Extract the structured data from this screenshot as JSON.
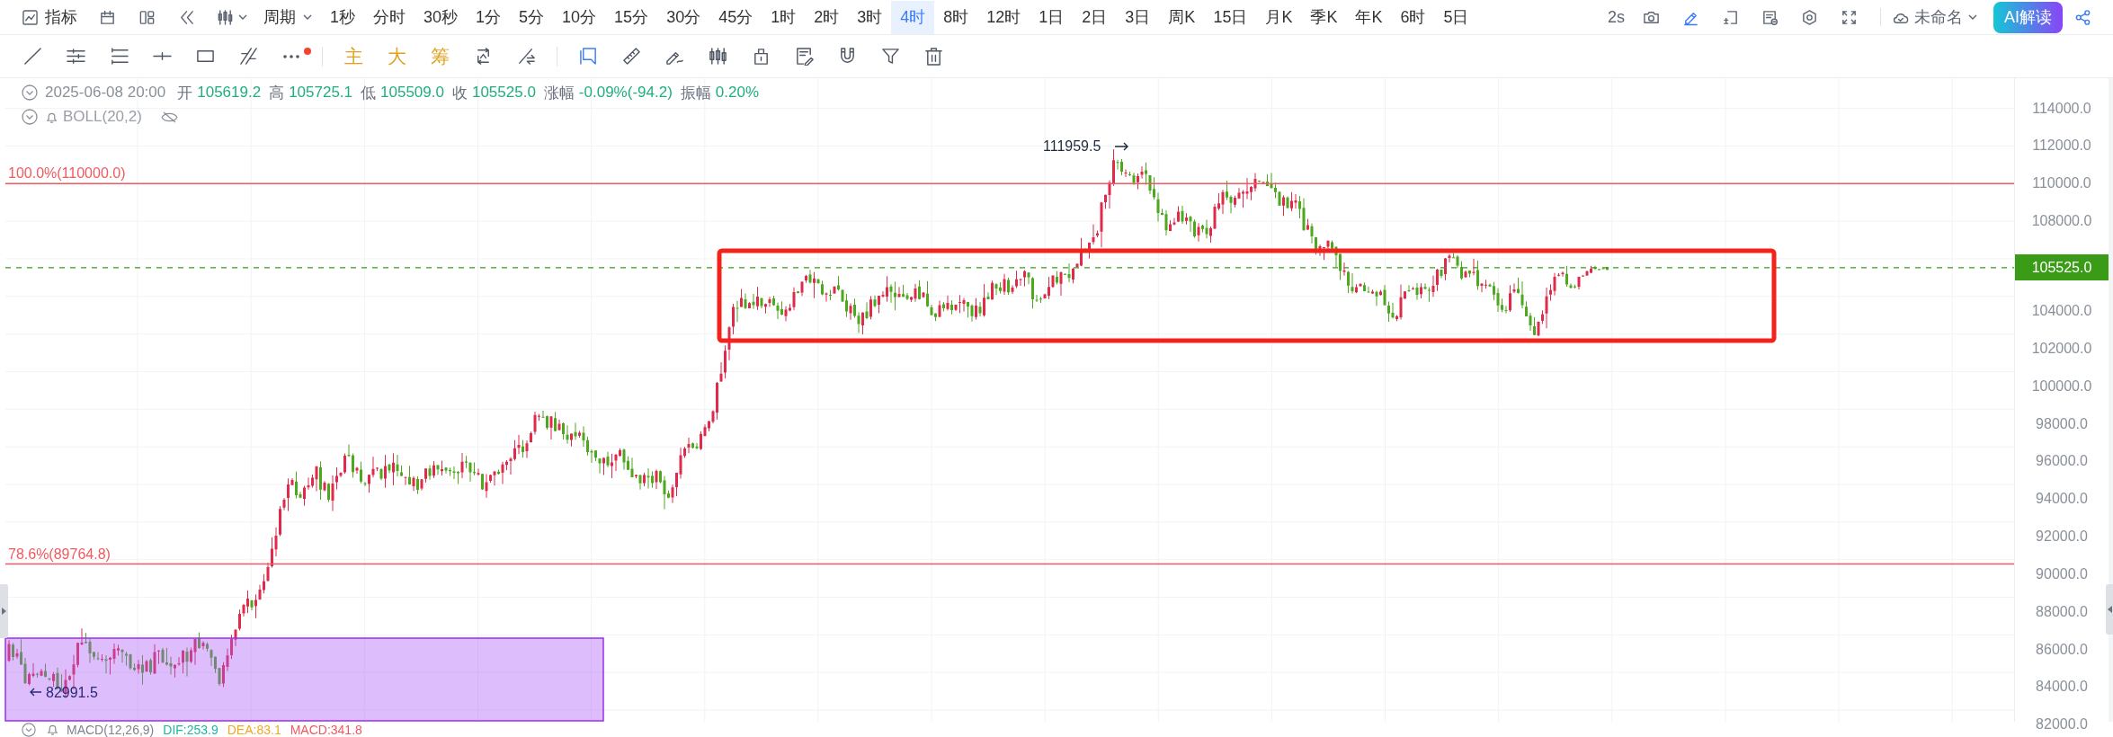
{
  "toolbar": {
    "indicators_button": {
      "label": "指标"
    },
    "period_menu": {
      "label": "周期"
    },
    "intervals": [
      {
        "label": "1秒",
        "selected": false
      },
      {
        "label": "分时",
        "selected": false
      },
      {
        "label": "30秒",
        "selected": false
      },
      {
        "label": "1分",
        "selected": false
      },
      {
        "label": "5分",
        "selected": false
      },
      {
        "label": "10分",
        "selected": false
      },
      {
        "label": "15分",
        "selected": false
      },
      {
        "label": "30分",
        "selected": false
      },
      {
        "label": "45分",
        "selected": false
      },
      {
        "label": "1时",
        "selected": false
      },
      {
        "label": "2时",
        "selected": false
      },
      {
        "label": "3时",
        "selected": false
      },
      {
        "label": "4时",
        "selected": true
      },
      {
        "label": "8时",
        "selected": false
      },
      {
        "label": "12时",
        "selected": false
      },
      {
        "label": "1日",
        "selected": false
      },
      {
        "label": "2日",
        "selected": false
      },
      {
        "label": "3日",
        "selected": false
      },
      {
        "label": "周K",
        "selected": false
      },
      {
        "label": "15日",
        "selected": false
      },
      {
        "label": "月K",
        "selected": false
      },
      {
        "label": "季K",
        "selected": false
      },
      {
        "label": "年K",
        "selected": false
      },
      {
        "label": "6时",
        "selected": false
      },
      {
        "label": "5日",
        "selected": false
      }
    ],
    "refresh_rate": {
      "label": "2s"
    },
    "draw_toggle": {
      "on": true
    },
    "layout_menu": {
      "label": "未命名"
    },
    "ai_button": {
      "label": "AI解读"
    }
  },
  "drawing_tools": {
    "more_badge": true,
    "quick_buttons": [
      {
        "label": "主"
      },
      {
        "label": "大"
      },
      {
        "label": "筹"
      }
    ],
    "keep_drawing": {
      "on": true
    }
  },
  "legend": {
    "datetime": "2025-06-08 20:00",
    "fields": [
      {
        "label": "开",
        "value": "105619.2"
      },
      {
        "label": "高",
        "value": "105725.1"
      },
      {
        "label": "低",
        "value": "105509.0"
      },
      {
        "label": "收",
        "value": "105525.0"
      },
      {
        "label": "涨幅",
        "value": "-0.09%(-94.2)"
      },
      {
        "label": "振幅",
        "value": "0.20%"
      }
    ]
  },
  "indicator_rows": [
    {
      "name": "BOLL(20,2)",
      "visible": false
    }
  ],
  "chart": {
    "fib_levels": [
      {
        "label": "100.0%(110000.0)"
      },
      {
        "label": "78.6%(89764.8)"
      }
    ],
    "high_marker": {
      "label": "111959.5"
    },
    "low_marker": {
      "label": "82991.5"
    }
  },
  "price_axis": {
    "upper_labels": [
      "114000.0",
      "112000.0",
      "110000.0",
      "108000.0"
    ],
    "current_price": "105525.0",
    "lower_labels": [
      "104000.0",
      "102000.0",
      "100000.0",
      "98000.0",
      "96000.0",
      "94000.0",
      "92000.0",
      "90000.0",
      "88000.0",
      "86000.0",
      "84000.0",
      "82000.0"
    ]
  },
  "macd": {
    "name": "MACD(12,26,9)",
    "values": [
      {
        "label": "DIF:253.9",
        "color": "#1fb5a5"
      },
      {
        "label": "DEA:83.1",
        "color": "#f5a623"
      },
      {
        "label": "MACD:341.8",
        "color": "#f0585f"
      }
    ]
  }
}
